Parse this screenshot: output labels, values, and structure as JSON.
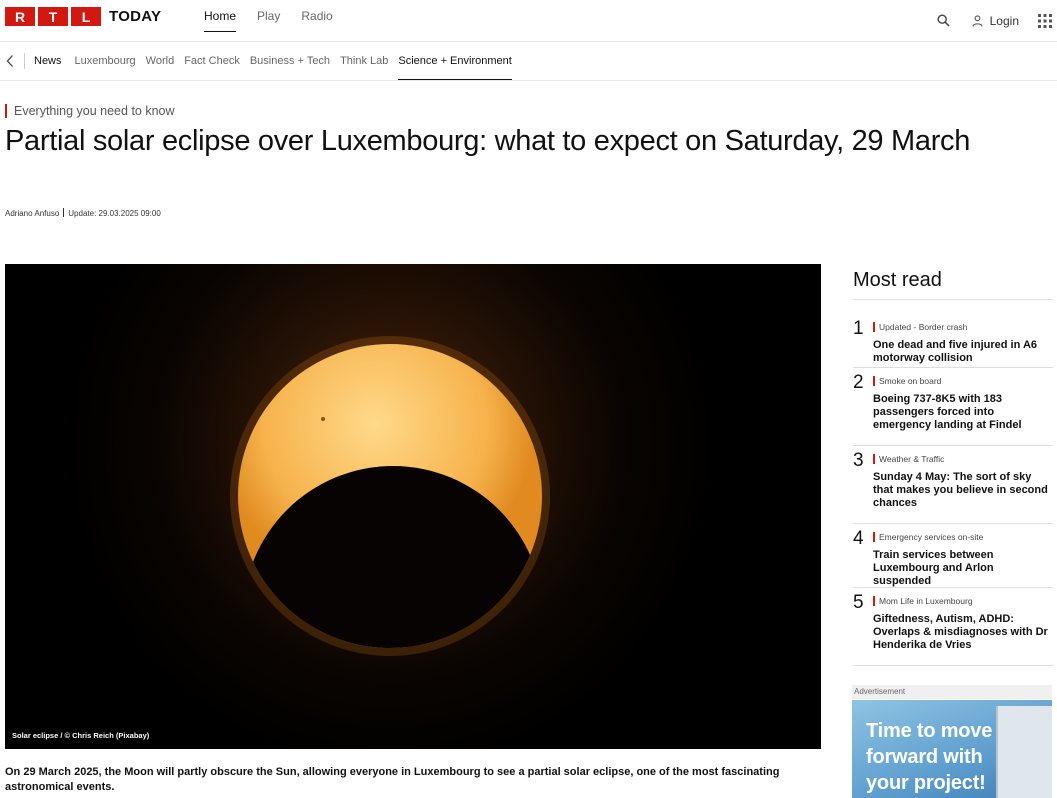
{
  "header": {
    "logo_letters": [
      "R",
      "T",
      "L"
    ],
    "logo_text": "TODAY",
    "nav": [
      "Home",
      "Play",
      "Radio"
    ],
    "login": "Login"
  },
  "subnav": {
    "section": "News",
    "items": [
      "Luxembourg",
      "World",
      "Fact Check",
      "Business + Tech",
      "Think Lab",
      "Science + Environment"
    ]
  },
  "article": {
    "kicker": "Everything you need to know",
    "title": "Partial solar eclipse over Luxembourg: what to expect on Saturday, 29 March",
    "author": "Adriano Anfuso",
    "updated": "Update: 29.03.2025 09:00",
    "image_caption": "Solar eclipse / © Chris Reich (Pixabay)",
    "lead": "On 29 March 2025, the Moon will partly obscure the Sun, allowing everyone in Luxembourg to see a partial solar eclipse, one of the most fascinating astronomical events."
  },
  "most_read": {
    "heading": "Most read",
    "items": [
      {
        "num": "1",
        "tag": "Updated - Border crash",
        "title": "One dead and five injured in A6 motorway collision"
      },
      {
        "num": "2",
        "tag": "Smoke on board",
        "title": "Boeing 737-8K5 with 183 passengers forced into emergency landing at Findel"
      },
      {
        "num": "3",
        "tag": "Weather & Traffic",
        "title": "Sunday 4 May: The sort of sky that makes you believe in second chances"
      },
      {
        "num": "4",
        "tag": "Emergency services on-site",
        "title": "Train services between Luxembourg and Arlon suspended"
      },
      {
        "num": "5",
        "tag": "Mom Life in Luxembourg",
        "title": "Giftedness, Autism, ADHD: Overlaps & misdiagnoses with Dr Henderika de Vries"
      }
    ]
  },
  "ad": {
    "label": "Advertisement",
    "line1": "Time to move",
    "line2": "forward with",
    "line3": "your project!"
  },
  "colors": {
    "brand_red": "#d3190f"
  }
}
